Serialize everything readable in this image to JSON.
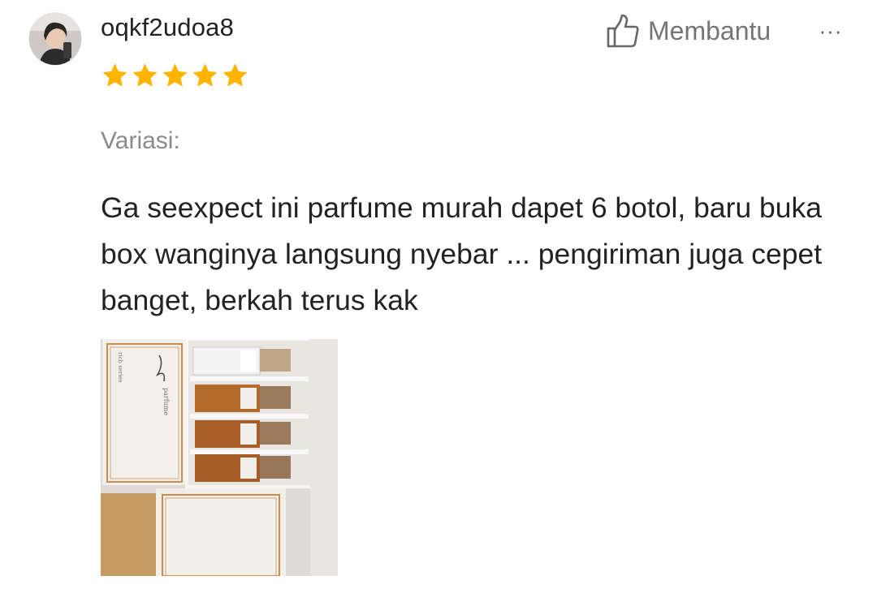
{
  "review": {
    "username": "oqkf2udoa8",
    "rating": 5,
    "rating_max": 5,
    "star_color": "#FFB400",
    "avatar_icon": "user-avatar",
    "helpful_icon": "thumbs-up-icon",
    "helpful_label": "Membantu",
    "more_icon": "more-options-icon",
    "more_label": "···",
    "variation_label": "Variasi:",
    "text": "Ga seexpect ini parfume murah dapet 6 botol, baru buka box wanginya langsung nyebar ... pengiriman juga cepet banget, berkah terus kak",
    "photo_icon": "review-photo"
  }
}
